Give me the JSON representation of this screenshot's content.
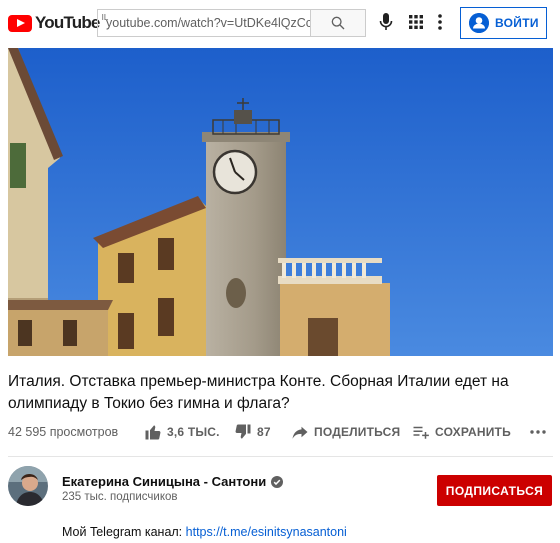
{
  "header": {
    "logo_text": "YouTube",
    "country_code": "IL",
    "address": "youtube.com/watch?v=UtDKe4lQzCc",
    "signin_label": "ВОЙТИ"
  },
  "video": {
    "title": "Италия. Отставка премьер-министра Конте. Сборная Италии едет на олимпиаду в Токио без гимна и флага?",
    "views": "42 595 просмотров",
    "likes": "3,6 ТЫС.",
    "dislikes": "87",
    "share_label": "ПОДЕЛИТЬСЯ",
    "save_label": "СОХРАНИТЬ"
  },
  "channel": {
    "name": "Екатерина Синицына - Сантони",
    "subscribers": "235 тыс. подписчиков",
    "subscribe_label": "ПОДПИСАТЬСЯ"
  },
  "description": {
    "text": "Мой Telegram канал: ",
    "link": "https://t.me/esinitsynasantoni"
  },
  "colors": {
    "brand_red": "#ff0000",
    "subscribe_red": "#cc0000",
    "link_blue": "#065fd4",
    "sky_blue": "#2a6cd0"
  },
  "icons": [
    "youtube-logo-icon",
    "search-icon",
    "mic-icon",
    "apps-icon",
    "more-vert-icon",
    "account-icon",
    "like-icon",
    "dislike-icon",
    "share-icon",
    "save-playlist-icon",
    "more-horiz-icon",
    "verified-icon"
  ]
}
